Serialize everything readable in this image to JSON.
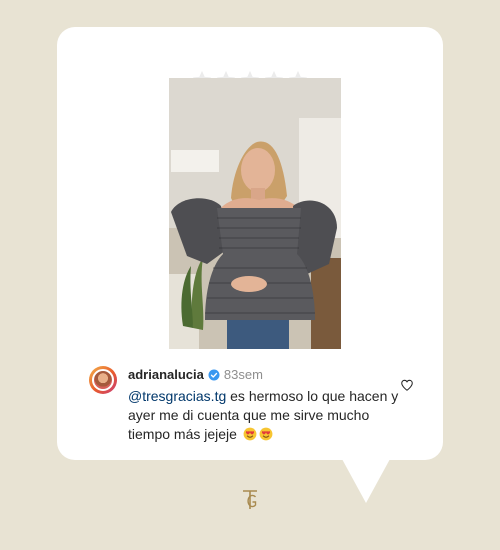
{
  "review": {
    "stars": 5,
    "star_icon": "star-icon"
  },
  "comment": {
    "username": "adrianalucia",
    "verified_icon": "verified-badge-icon",
    "time": "83sem",
    "mention": "@tresgracias.tg",
    "text": " es hermoso lo que hacen y ayer me di cuenta que me sirve mucho tiempo más jejeje",
    "emojis": [
      "heart-eyes-emoji",
      "heart-eyes-emoji"
    ],
    "like_icon": "heart-outline-icon"
  },
  "brand": {
    "logo_icon": "tg-monogram-icon",
    "logo_text": "TG"
  },
  "colors": {
    "background": "#e8e3d3",
    "card": "#ffffff",
    "mention": "#00376b",
    "verified": "#3897f0",
    "logo": "#a88a4f"
  }
}
